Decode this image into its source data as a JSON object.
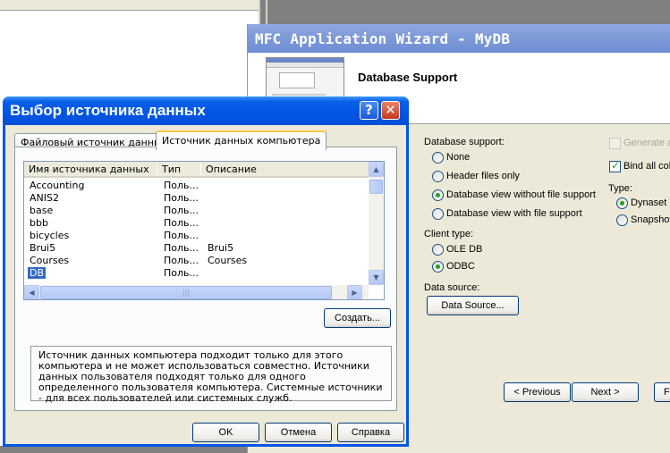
{
  "wizard": {
    "title": "MFC Application Wizard - MyDB",
    "heading": "Database Support",
    "database_support_label": "Database support:",
    "support_options": [
      {
        "label": "None",
        "selected": false
      },
      {
        "label": "Header files only",
        "selected": false
      },
      {
        "label": "Database view without file support",
        "selected": true
      },
      {
        "label": "Database view with file support",
        "selected": false
      }
    ],
    "client_type_label": "Client type:",
    "client_options": [
      {
        "label": "OLE DB",
        "selected": false
      },
      {
        "label": "ODBC",
        "selected": true
      }
    ],
    "data_source_label": "Data source:",
    "data_source_button": "Data Source...",
    "generate_label": "Generate a",
    "bind_all_label": "Bind all colu",
    "bind_all_checked": true,
    "type_label": "Type:",
    "type_options": [
      {
        "label": "Dynaset",
        "selected": true
      },
      {
        "label": "Snapshot",
        "selected": false
      }
    ],
    "previous_button": "< Previous",
    "next_button": "Next >",
    "finish_button": "F"
  },
  "dialog": {
    "title": "Выбор источника данных",
    "tabs": [
      {
        "label": "Файловый источник данных",
        "active": false
      },
      {
        "label": "Источник данных компьютера",
        "active": true
      }
    ],
    "columns": [
      "Имя источника данных",
      "Тип",
      "Описание"
    ],
    "rows": [
      {
        "name": "Accounting",
        "type": "Поль...",
        "desc": ""
      },
      {
        "name": "ANIS2",
        "type": "Поль...",
        "desc": ""
      },
      {
        "name": "base",
        "type": "Поль...",
        "desc": ""
      },
      {
        "name": "bbb",
        "type": "Поль...",
        "desc": ""
      },
      {
        "name": "bicycles",
        "type": "Поль...",
        "desc": ""
      },
      {
        "name": "Brui5",
        "type": "Поль...",
        "desc": "Brui5"
      },
      {
        "name": "Courses",
        "type": "Поль...",
        "desc": "Courses"
      },
      {
        "name": "DB",
        "type": "Поль...",
        "desc": ""
      }
    ],
    "selected_row": "DB",
    "create_button": "Создать...",
    "description": "Источник данных компьютера подходит только для этого компьютера и не может использоваться совместно.  Источники данных пользователя подходят только для одного определенного пользователя компьютера. Системные источники - для всех пользователей или системных служб.",
    "ok_button": "OK",
    "cancel_button": "Отмена",
    "help_button": "Справка",
    "help_icon": "?",
    "close_icon": "✕"
  }
}
